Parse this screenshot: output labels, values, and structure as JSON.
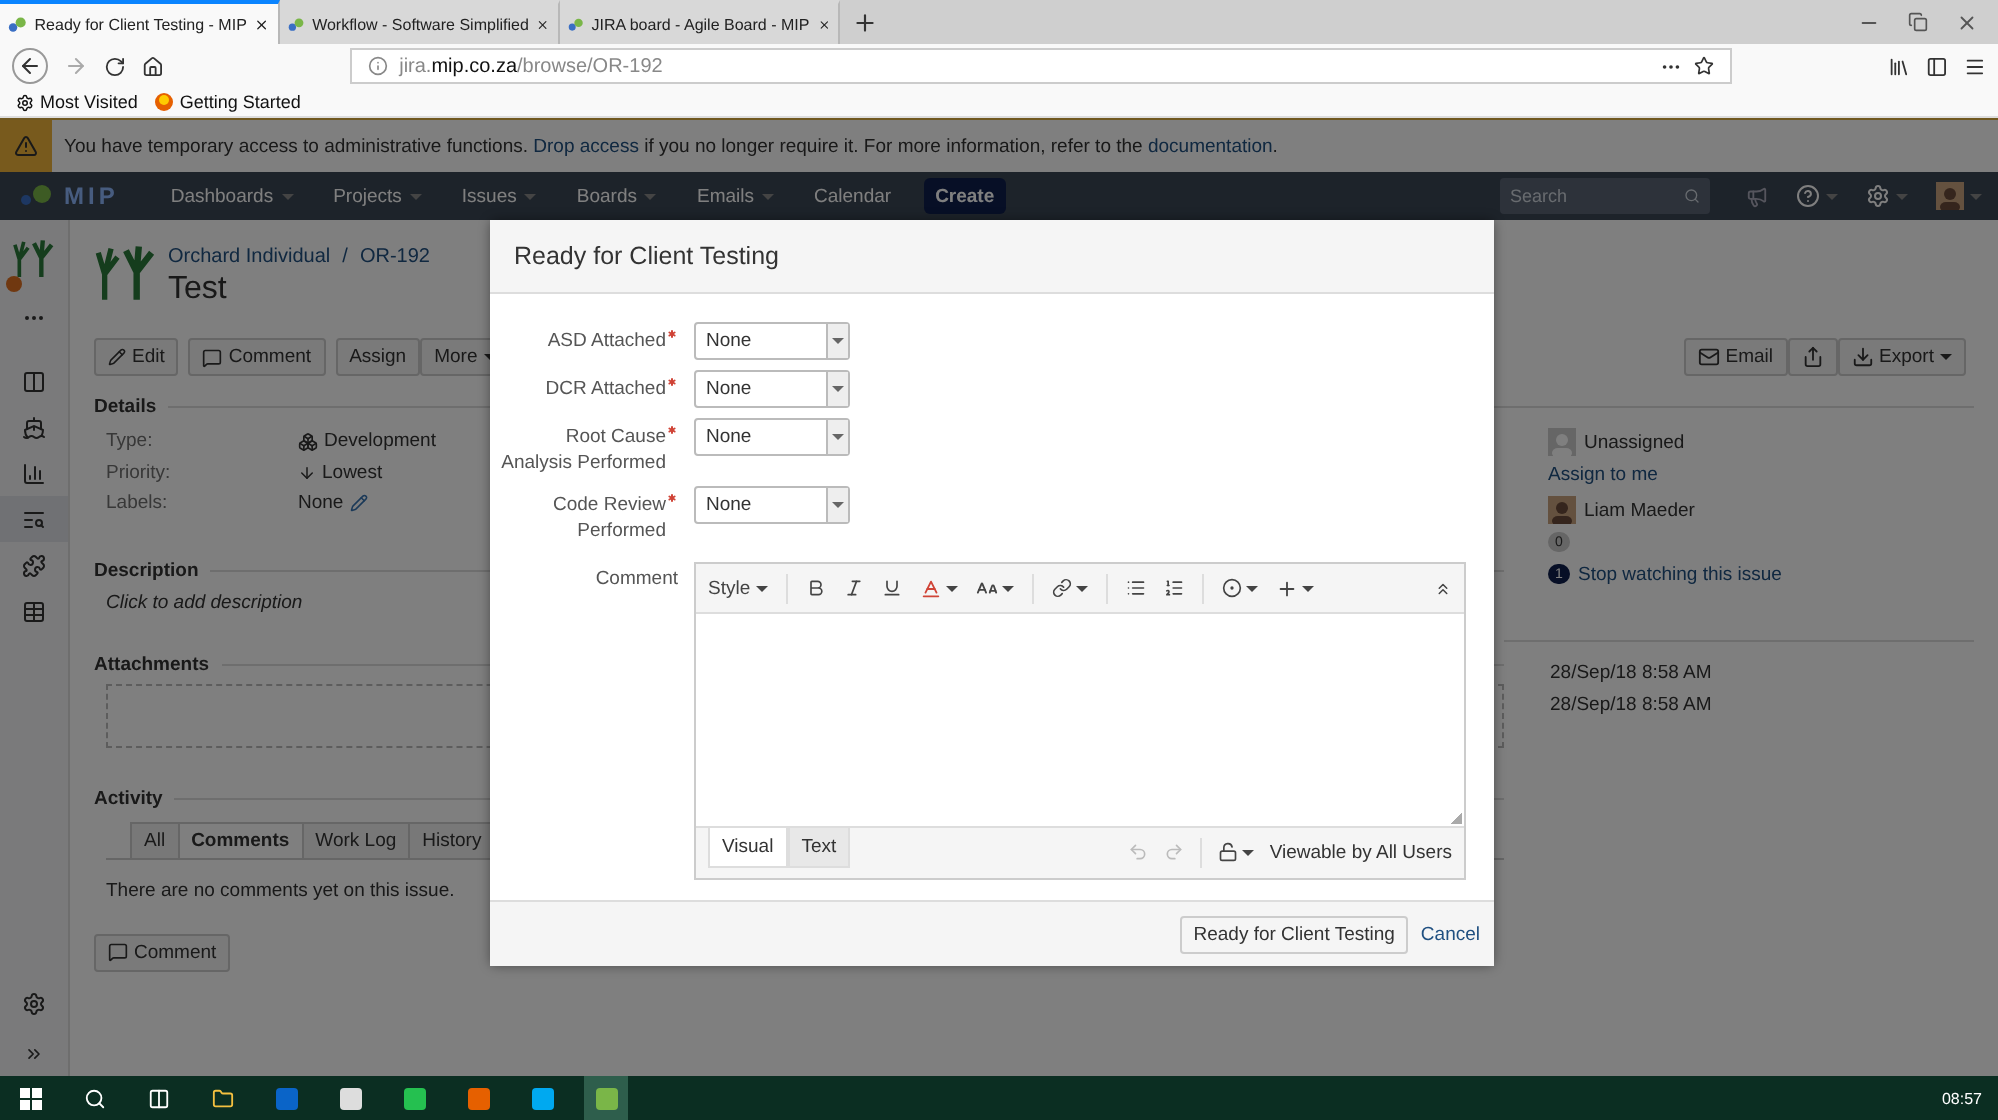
{
  "browser": {
    "tabs": [
      {
        "title": "Ready for Client Testing - MIP",
        "selected": true
      },
      {
        "title": "Workflow - Software Simplified",
        "selected": false
      },
      {
        "title": "JIRA board - Agile Board - MIP",
        "selected": false
      }
    ],
    "url": "jira.**mip.co.za**/browse/OR-192",
    "bookmarks": [
      {
        "label": "Most Visited",
        "kind": "folder"
      },
      {
        "label": "Getting Started",
        "kind": "site"
      }
    ]
  },
  "alert": {
    "segments": [
      {
        "text": "You have temporary access to administrative functions. ",
        "link": false
      },
      {
        "text": "Drop access",
        "link": true
      },
      {
        "text": " if you no longer require it. For more information, refer to the ",
        "link": false
      },
      {
        "text": "documentation",
        "link": true
      },
      {
        "text": ".",
        "link": false
      }
    ]
  },
  "header": {
    "logo": "MIP",
    "nav": [
      {
        "label": "Dashboards",
        "dropdown": true
      },
      {
        "label": "Projects",
        "dropdown": true
      },
      {
        "label": "Issues",
        "dropdown": true
      },
      {
        "label": "Boards",
        "dropdown": true
      },
      {
        "label": "Emails",
        "dropdown": true
      },
      {
        "label": "Calendar",
        "dropdown": false
      }
    ],
    "create": "Create",
    "search_placeholder": "Search"
  },
  "issue": {
    "project": "Orchard Individual",
    "separator": "/",
    "key": "OR-192",
    "title": "Test",
    "actions": [
      {
        "label": "Edit",
        "kind": "edit"
      },
      {
        "label": "Comment",
        "kind": "comment"
      },
      {
        "label": "Assign",
        "kind": "plain"
      },
      {
        "label": "More",
        "kind": "menu"
      }
    ],
    "right_actions": [
      {
        "label": "Email",
        "kind": "email"
      },
      {
        "kind": "share"
      },
      {
        "label": "Export",
        "kind": "export"
      }
    ],
    "details_heading": "Details",
    "details": [
      {
        "label": "Type:",
        "value": "Development",
        "kind": "type"
      },
      {
        "label": "Priority:",
        "value": "Lowest",
        "kind": "priority"
      },
      {
        "label": "Labels:",
        "value": "None",
        "kind": "labels"
      }
    ],
    "description_heading": "Description",
    "description_placeholder": "Click to add description",
    "attachments_heading": "Attachments",
    "activity_heading": "Activity",
    "activity_tabs": [
      {
        "label": "All",
        "selected": false
      },
      {
        "label": "Comments",
        "selected": true
      },
      {
        "label": "Work Log",
        "selected": false
      },
      {
        "label": "History",
        "selected": false
      }
    ],
    "no_comments": "There are no comments yet on this issue.",
    "comment_button": "Comment"
  },
  "people": {
    "assignee": "Unassigned",
    "assign_to_me": "Assign to me",
    "reporter": "Liam Maeder",
    "votes": "0",
    "watchers": "1",
    "stop_watching": "Stop watching this issue"
  },
  "dates": [
    "28/Sep/18 8:58 AM",
    "28/Sep/18 8:58 AM"
  ],
  "modal": {
    "title": "Ready for Client Testing",
    "fields": [
      {
        "label_lines": [
          "ASD Attached"
        ],
        "required": true,
        "value": "None"
      },
      {
        "label_lines": [
          "DCR Attached"
        ],
        "required": true,
        "value": "None"
      },
      {
        "label_lines": [
          "Root Cause",
          "Analysis Performed"
        ],
        "required": true,
        "value": "None"
      },
      {
        "label_lines": [
          "Code Review",
          "Performed"
        ],
        "required": true,
        "value": "None"
      }
    ],
    "comment_label": "Comment",
    "style_menu": "Style",
    "editor_tabs": [
      {
        "label": "Visual",
        "selected": true
      },
      {
        "label": "Text",
        "selected": false
      }
    ],
    "visibility": "Viewable by All Users",
    "submit": "Ready for Client Testing",
    "cancel": "Cancel"
  },
  "taskbar": {
    "time": "08:57"
  }
}
